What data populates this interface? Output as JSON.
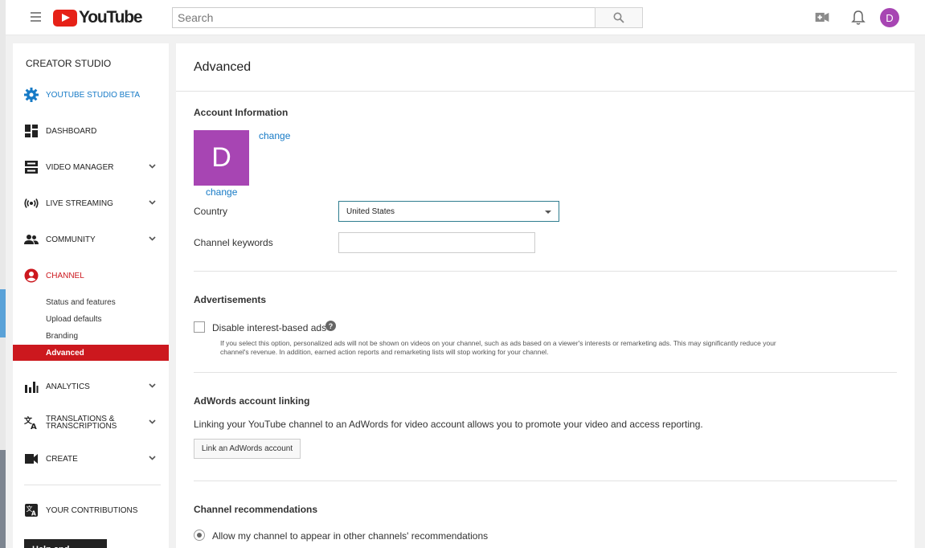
{
  "topbar": {
    "logo_text": "YouTube",
    "search_placeholder": "Search"
  },
  "avatar_letter": "D",
  "sidebar": {
    "title": "CREATOR STUDIO",
    "items": [
      {
        "label": "YOUTUBE STUDIO BETA",
        "icon": "gear-icon",
        "color": "#167ac6"
      },
      {
        "label": "DASHBOARD",
        "icon": "dashboard-icon"
      },
      {
        "label": "VIDEO MANAGER",
        "icon": "video-manager-icon"
      },
      {
        "label": "LIVE STREAMING",
        "icon": "live-icon"
      },
      {
        "label": "COMMUNITY",
        "icon": "community-icon"
      },
      {
        "label": "CHANNEL",
        "icon": "channel-icon",
        "color": "#cc181e"
      },
      {
        "label": "ANALYTICS",
        "icon": "analytics-icon"
      },
      {
        "label": "TRANSLATIONS & TRANSCRIPTIONS",
        "icon": "translate-icon"
      },
      {
        "label": "CREATE",
        "icon": "create-icon"
      },
      {
        "label": "YOUR CONTRIBUTIONS",
        "icon": "contributions-icon"
      }
    ],
    "channel_sub": [
      "Status and features",
      "Upload defaults",
      "Branding",
      "Advanced"
    ],
    "feedback_label": "Help and feedback"
  },
  "main": {
    "title": "Advanced",
    "account": {
      "heading": "Account Information",
      "change_link_1": "change",
      "change_link_2": "change",
      "country_label": "Country",
      "country_value": "United States",
      "keywords_label": "Channel keywords",
      "keywords_value": ""
    },
    "ads": {
      "heading": "Advertisements",
      "checkbox_label": "Disable interest-based ads",
      "note": "If you select this option, personalized ads will not be shown on videos on your channel, such as ads based on a viewer's interests or remarketing ads. This may significantly reduce your channel's revenue. In addition, earned action reports and remarketing lists will stop working for your channel."
    },
    "adwords": {
      "heading": "AdWords account linking",
      "description": "Linking your YouTube channel to an AdWords for video account allows you to promote your video and access reporting.",
      "button_label": "Link an AdWords account"
    },
    "recommendations": {
      "heading": "Channel recommendations",
      "radio_label": "Allow my channel to appear in other channels' recommendations"
    }
  },
  "colors": {
    "brand_red": "#e62117",
    "active_red": "#cc181e",
    "link_blue": "#167ac6",
    "avatar_purple": "#a745b3"
  }
}
